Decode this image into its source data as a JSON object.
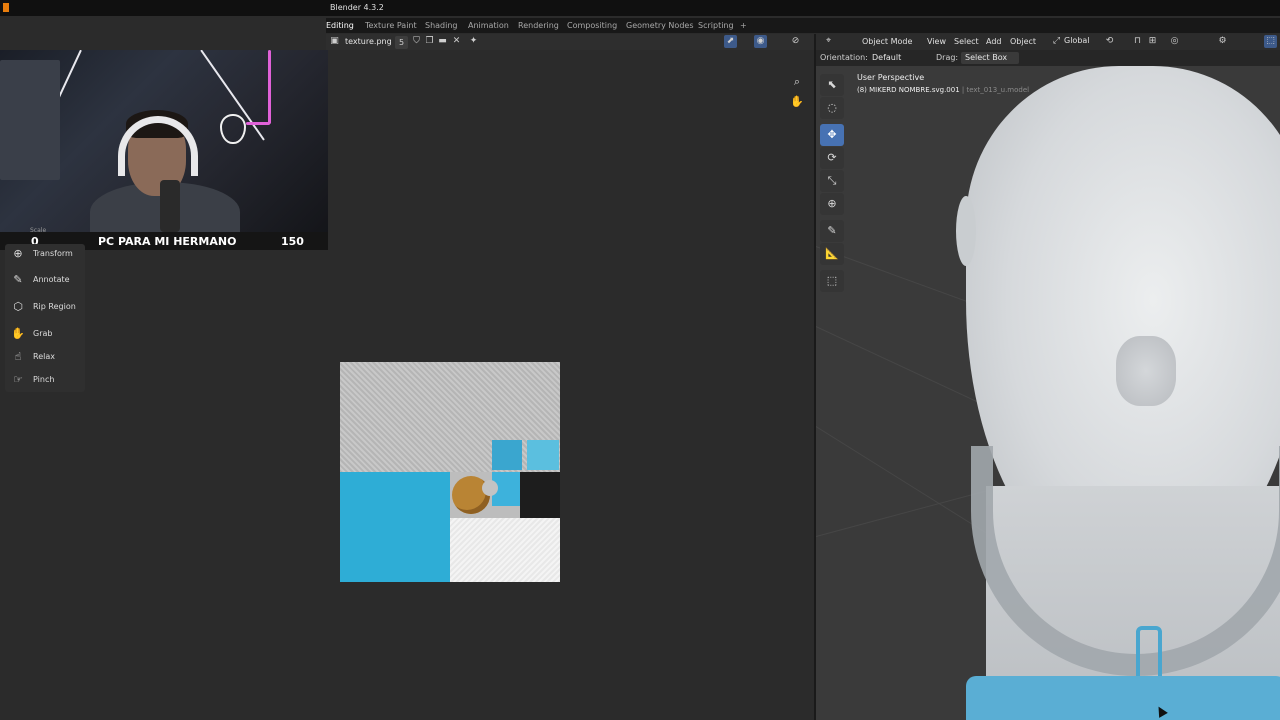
{
  "window": {
    "title": "Blender 4.3.2"
  },
  "workspace_tabs": [
    {
      "label": "Editing",
      "active": true
    },
    {
      "label": "Texture Paint"
    },
    {
      "label": "Shading"
    },
    {
      "label": "Animation"
    },
    {
      "label": "Rendering"
    },
    {
      "label": "Compositing"
    },
    {
      "label": "Geometry Nodes"
    },
    {
      "label": "Scripting"
    },
    {
      "label": "+"
    }
  ],
  "uv_editor": {
    "image_name": "texture.png",
    "users": "5",
    "tools": [
      {
        "label": "Transform",
        "icon": "transform-icon",
        "glyph": "⊕"
      },
      {
        "label": "Annotate",
        "icon": "pencil-icon",
        "glyph": "✎"
      },
      {
        "label": "Rip Region",
        "icon": "rip-icon",
        "glyph": "⬡"
      },
      {
        "label": "Grab",
        "icon": "grab-icon",
        "glyph": "✋"
      },
      {
        "label": "Relax",
        "icon": "relax-icon",
        "glyph": "☝"
      },
      {
        "label": "Pinch",
        "icon": "pinch-icon",
        "glyph": "☞"
      }
    ]
  },
  "overlay": {
    "scale_label": "Scale",
    "counter_left": "0",
    "counter_title": "PC PARA MI HERMANO",
    "counter_right": "150"
  },
  "viewport": {
    "mode": "Object Mode",
    "menus": [
      "View",
      "Select",
      "Add",
      "Object"
    ],
    "transform_orientation": "Global",
    "orientation_label": "Orientation:",
    "orientation_value": "Default",
    "drag_label": "Drag:",
    "drag_value": "Select Box",
    "view_name": "User Perspective",
    "object_info": "(8) MIKERD NOMBRE.svg.001",
    "object_info_extra": "| text_013_u.model"
  },
  "colors": {
    "accent": "#4772b3",
    "texture_blue": "#2eadd6",
    "blender_orange": "#e87d0d"
  }
}
